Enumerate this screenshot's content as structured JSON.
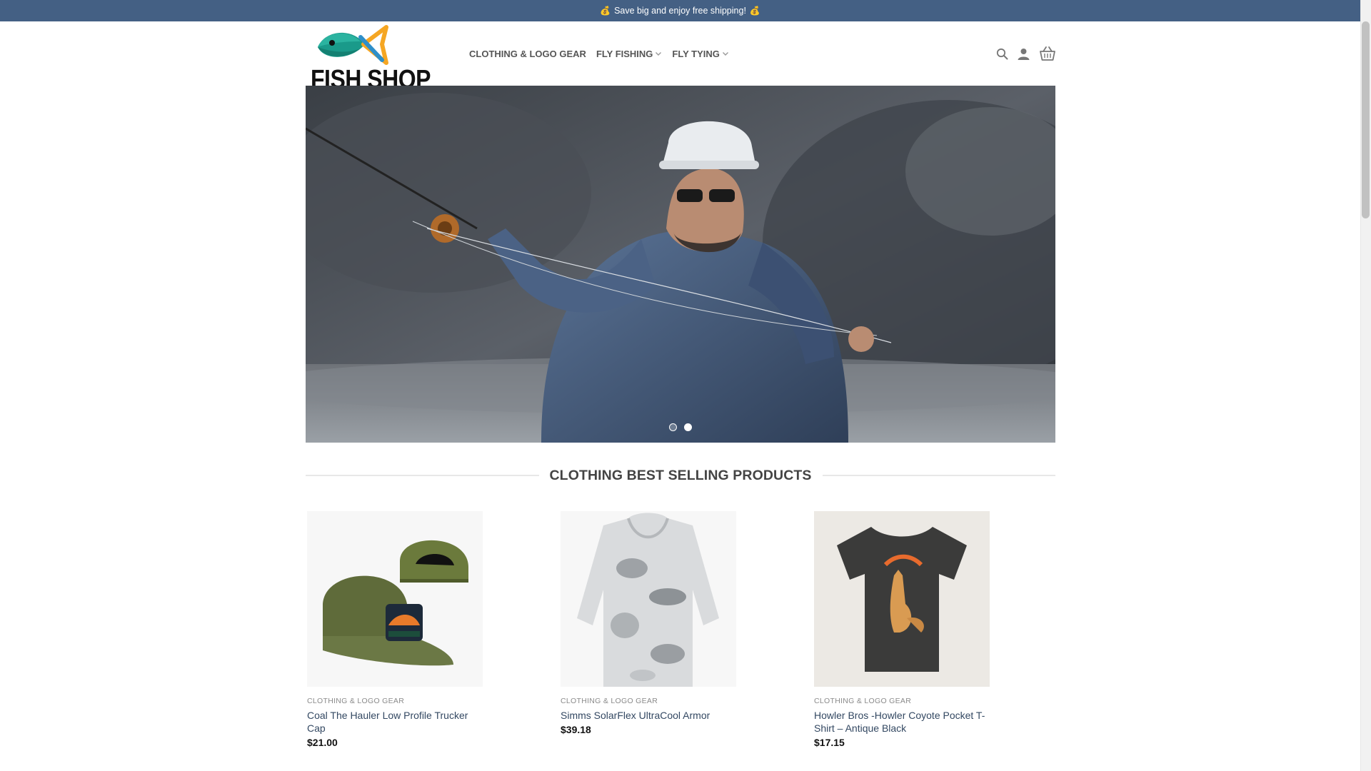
{
  "topbar": {
    "message": "Save big and enjoy free shipping!",
    "icon_left": "money-bag-icon",
    "icon_right": "money-bag-icon"
  },
  "header": {
    "logo_text": "FISH SHOP",
    "nav": [
      {
        "label": "CLOTHING & LOGO GEAR",
        "has_dropdown": false
      },
      {
        "label": "FLY FISHING",
        "has_dropdown": true
      },
      {
        "label": "FLY TYING",
        "has_dropdown": true
      }
    ],
    "icons": [
      "search-icon",
      "account-icon",
      "basket-icon"
    ]
  },
  "hero": {
    "slide_count": 2,
    "active_slide": 2
  },
  "section": {
    "title": "CLOTHING BEST SELLING PRODUCTS"
  },
  "products": [
    {
      "category": "CLOTHING & LOGO GEAR",
      "name": "Coal The Hauler Low Profile Trucker Cap",
      "price": "$21.00"
    },
    {
      "category": "CLOTHING & LOGO GEAR",
      "name": "Simms SolarFlex UltraCool Armor",
      "price": "$39.18"
    },
    {
      "category": "CLOTHING & LOGO GEAR",
      "name": "Howler Bros -Howler Coyote Pocket T-Shirt – Antique Black",
      "price": "$17.15"
    }
  ],
  "colors": {
    "topbar": "#446084",
    "link": "#334862",
    "nav_text": "#555555"
  }
}
